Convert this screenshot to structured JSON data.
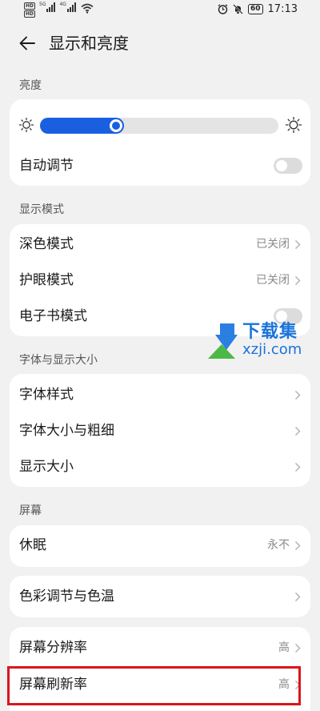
{
  "status_bar": {
    "hd1": "HD",
    "hd2": "HD",
    "net1": "5G",
    "net2": "4G",
    "battery": "60",
    "time": "17:13"
  },
  "header": {
    "title": "显示和亮度"
  },
  "brightness": {
    "section_label": "亮度",
    "level": 0.32,
    "accent_color": "#1a5fe0",
    "auto_label": "自动调节",
    "auto_on": false
  },
  "display_mode": {
    "section_label": "显示模式",
    "dark_mode": {
      "label": "深色模式",
      "value": "已关闭"
    },
    "eye_comfort": {
      "label": "护眼模式",
      "value": "已关闭"
    },
    "ebook_mode": {
      "label": "电子书模式",
      "on": false
    }
  },
  "font_size": {
    "section_label": "字体与显示大小",
    "font_style": {
      "label": "字体样式"
    },
    "font_size_weight": {
      "label": "字体大小与粗细"
    },
    "display_size": {
      "label": "显示大小"
    }
  },
  "screen": {
    "section_label": "屏幕",
    "sleep": {
      "label": "休眠",
      "value": "永不"
    },
    "color_temp": {
      "label": "色彩调节与色温"
    },
    "resolution": {
      "label": "屏幕分辨率",
      "value": "高"
    },
    "refresh_rate": {
      "label": "屏幕刷新率",
      "value": "高"
    }
  },
  "watermark": {
    "title": "下载集",
    "domain": "xzji.com"
  },
  "highlight_color": "#d9161c"
}
